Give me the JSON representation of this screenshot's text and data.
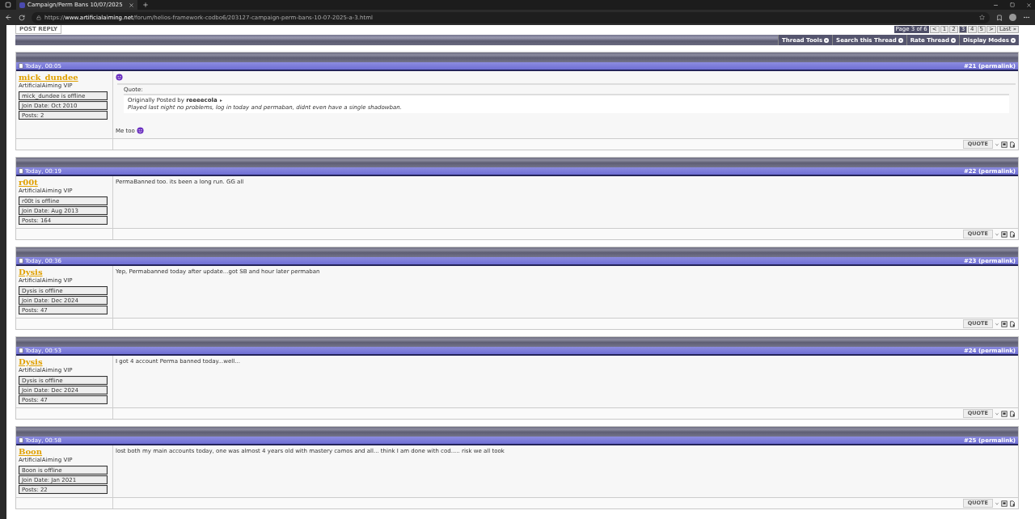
{
  "browser": {
    "tab_title": "Campaign/Perm Bans 10/07/2025",
    "url": "https://**www.artificialaiming.net**/forum/helios-framework-codbo6/203127-campaign-perm-bans-10-07-2025-a-3.html"
  },
  "top": {
    "post_reply": "POST REPLY",
    "pagination": {
      "label": "Page 3 of 6",
      "pages": [
        {
          "label": "<",
          "selected": false
        },
        {
          "label": "1",
          "selected": false
        },
        {
          "label": "2",
          "selected": false
        },
        {
          "label": "3",
          "selected": true
        },
        {
          "label": "4",
          "selected": false
        },
        {
          "label": "5",
          "selected": false
        },
        {
          "label": ">",
          "selected": false
        },
        {
          "label": "Last »",
          "selected": false
        }
      ]
    },
    "thread_tools": [
      "Thread Tools",
      "Search this Thread",
      "Rate Thread",
      "Display Modes"
    ]
  },
  "posts": [
    {
      "date": "Today, 00:05",
      "number": "#21",
      "permalink": "(permalink)",
      "username": "mick_dundee",
      "rank": "ArtificialAiming VIP",
      "status": "mick_dundee is offline",
      "join_date": "Join Date: Oct 2010",
      "post_count": "Posts: 2",
      "quote_button": "QUOTE",
      "blocks": [
        {
          "kind": "smiley"
        },
        {
          "kind": "quote",
          "label": "Quote:",
          "intro": "Originally Posted by **reeeecola**",
          "text": "Played last night no problems, log in today and permaban, didnt even have a single shadowban."
        },
        {
          "kind": "text",
          "text": "Me too",
          "smiley": true
        }
      ]
    },
    {
      "date": "Today, 00:19",
      "number": "#22",
      "permalink": "(permalink)",
      "username": "r00t",
      "rank": "ArtificialAiming VIP",
      "status": "r00t is offline",
      "join_date": "Join Date: Aug 2013",
      "post_count": "Posts: 164",
      "quote_button": "QUOTE",
      "blocks": [
        {
          "kind": "text",
          "text": "PermaBanned too. its been a long run. GG all",
          "smiley": false
        }
      ]
    },
    {
      "date": "Today, 00:36",
      "number": "#23",
      "permalink": "(permalink)",
      "username": "Dysis",
      "rank": "ArtificialAiming VIP",
      "status": "Dysis is offline",
      "join_date": "Join Date: Dec 2024",
      "post_count": "Posts: 47",
      "quote_button": "QUOTE",
      "blocks": [
        {
          "kind": "text",
          "text": "Yep, Permabanned today after update...got SB and hour later permaban",
          "smiley": false
        }
      ]
    },
    {
      "date": "Today, 00:53",
      "number": "#24",
      "permalink": "(permalink)",
      "username": "Dysis",
      "rank": "ArtificialAiming VIP",
      "status": "Dysis is offline",
      "join_date": "Join Date: Dec 2024",
      "post_count": "Posts: 47",
      "quote_button": "QUOTE",
      "blocks": [
        {
          "kind": "text",
          "text": "I got 4 account Perma banned today...well...",
          "smiley": false
        }
      ]
    },
    {
      "date": "Today, 00:58",
      "number": "#25",
      "permalink": "(permalink)",
      "username": "Boon",
      "rank": "ArtificialAiming VIP",
      "status": "Boon is offline",
      "join_date": "Join Date: Jan 2021",
      "post_count": "Posts: 22",
      "quote_button": "QUOTE",
      "blocks": [
        {
          "kind": "text",
          "text": "lost both my main accounts today, one was almost 4 years old with mastery camos and all... think I am done with cod..... risk we all took",
          "smiley": false
        }
      ]
    }
  ]
}
